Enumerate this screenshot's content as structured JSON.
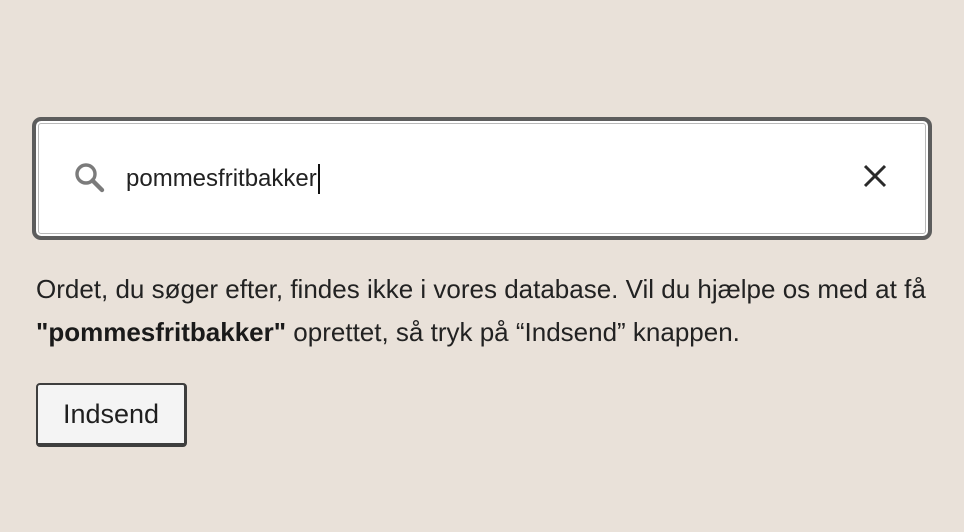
{
  "search": {
    "value": "pommesfritbakker",
    "icon": "search-icon",
    "clear_icon": "close-icon"
  },
  "message": {
    "part1": "Ordet, du søger efter, findes ikke i vores database. Vil du hjælpe os med at få ",
    "highlighted_word": "\"pommesfritbakker\"",
    "part2": " oprettet, så tryk på “Indsend” knappen."
  },
  "submit_button": {
    "label": "Indsend"
  },
  "colors": {
    "background": "#e9e1d9",
    "field_border": "#5d5d5d",
    "text": "#222222"
  }
}
